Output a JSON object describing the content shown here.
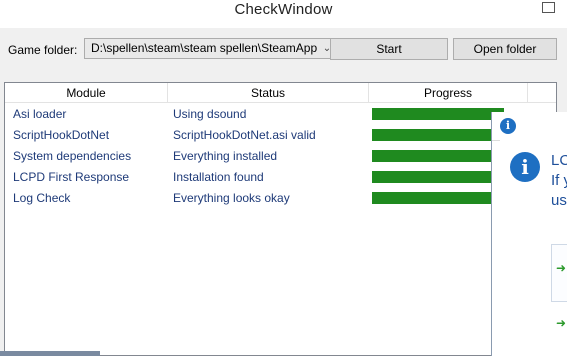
{
  "window": {
    "title": "CheckWindow"
  },
  "toolbar": {
    "folder_label": "Game folder:",
    "folder_value": "D:\\spellen\\steam\\steam spellen\\SteamApp",
    "start_label": "Start",
    "open_folder_label": "Open folder"
  },
  "table": {
    "columns": [
      "Module",
      "Status",
      "Progress"
    ],
    "rows": [
      {
        "module": "Asi loader",
        "status": "Using dsound",
        "progress": 1.0
      },
      {
        "module": "ScriptHookDotNet",
        "status": "ScriptHookDotNet.asi valid",
        "progress": 1.0
      },
      {
        "module": "System dependencies",
        "status": "Everything installed",
        "progress": 1.0
      },
      {
        "module": "LCPD First Response",
        "status": "Installation found",
        "progress": 1.0
      },
      {
        "module": "Log Check",
        "status": "Everything looks okay",
        "progress": 1.0
      }
    ],
    "progress_color": "#1f8a1f"
  },
  "dialog": {
    "title_icon": "info-icon",
    "line1": "LC",
    "line2": "If y",
    "line3": "us",
    "option_icon": "arrow-right-icon"
  }
}
